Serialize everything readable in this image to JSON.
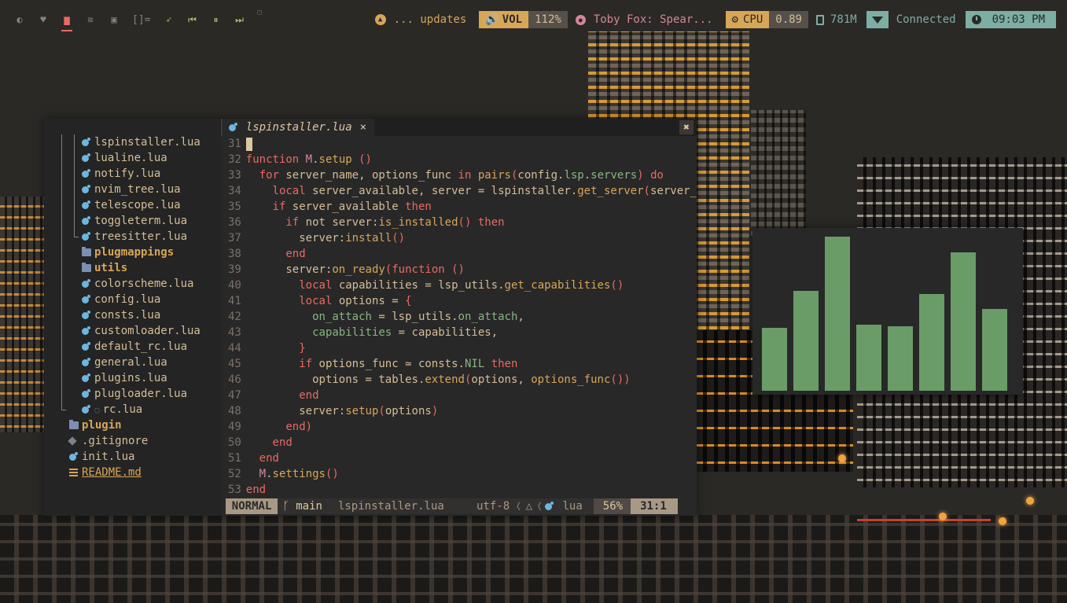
{
  "topbar": {
    "workspaces": [
      {
        "icon": "firefox-icon",
        "glyph": "◐",
        "active": false
      },
      {
        "icon": "pocket-icon",
        "glyph": "♥",
        "active": false
      },
      {
        "icon": "mail-icon",
        "glyph": "▆",
        "active": true
      },
      {
        "icon": "spotify-icon",
        "glyph": "≋",
        "active": false
      },
      {
        "icon": "discord-icon",
        "glyph": "▣",
        "active": false
      }
    ],
    "layout_indicator": "[]=",
    "media_controls": [
      {
        "icon": "rocket-icon",
        "glyph": "➶"
      },
      {
        "icon": "previous-icon",
        "glyph": "⏮"
      },
      {
        "icon": "pause-icon",
        "glyph": "⏸"
      },
      {
        "icon": "next-icon",
        "glyph": "⏭"
      }
    ],
    "updates": "... updates",
    "volume_label": "VOL",
    "volume_value": "112%",
    "music": "Toby Fox: Spear...",
    "cpu_label": "CPU",
    "cpu_value": "0.89",
    "memory": "781M",
    "network": "Connected",
    "clock": "09:03 PM",
    "colors": {
      "accent_yellow": "#d8a657",
      "accent_teal": "#7daea3",
      "accent_pink": "#d3869b",
      "accent_red": "#ea6962"
    }
  },
  "tree": {
    "items": [
      {
        "guides": [
          "v",
          "v"
        ],
        "icon": "lua",
        "name": "lspinstaller.lua"
      },
      {
        "guides": [
          "v",
          "v"
        ],
        "icon": "lua",
        "name": "lualine.lua"
      },
      {
        "guides": [
          "v",
          "v"
        ],
        "icon": "lua",
        "name": "notify.lua"
      },
      {
        "guides": [
          "v",
          "v"
        ],
        "icon": "lua",
        "name": "nvim_tree.lua"
      },
      {
        "guides": [
          "v",
          "v"
        ],
        "icon": "lua",
        "name": "telescope.lua"
      },
      {
        "guides": [
          "v",
          "v"
        ],
        "icon": "lua",
        "name": "toggleterm.lua"
      },
      {
        "guides": [
          "v",
          "end"
        ],
        "icon": "lua",
        "name": "treesitter.lua"
      },
      {
        "guides": [
          "v",
          "blank"
        ],
        "icon": "folder",
        "name": "plugmappings",
        "folder": true
      },
      {
        "guides": [
          "v",
          "blank"
        ],
        "icon": "folder",
        "name": "utils",
        "folder": true
      },
      {
        "guides": [
          "v",
          "blank"
        ],
        "icon": "lua",
        "name": "colorscheme.lua"
      },
      {
        "guides": [
          "v",
          "blank"
        ],
        "icon": "lua",
        "name": "config.lua"
      },
      {
        "guides": [
          "v",
          "blank"
        ],
        "icon": "lua",
        "name": "consts.lua"
      },
      {
        "guides": [
          "v",
          "blank"
        ],
        "icon": "lua",
        "name": "customloader.lua"
      },
      {
        "guides": [
          "v",
          "blank"
        ],
        "icon": "lua",
        "name": "default_rc.lua"
      },
      {
        "guides": [
          "v",
          "blank"
        ],
        "icon": "lua",
        "name": "general.lua"
      },
      {
        "guides": [
          "v",
          "blank"
        ],
        "icon": "lua",
        "name": "plugins.lua"
      },
      {
        "guides": [
          "v",
          "blank"
        ],
        "icon": "lua",
        "name": "plugloader.lua"
      },
      {
        "guides": [
          "end",
          "blank"
        ],
        "icon": "lua",
        "name": "rc.lua",
        "hollow": true
      },
      {
        "guides": [
          "blank"
        ],
        "icon": "folder",
        "name": "plugin",
        "folder": true
      },
      {
        "guides": [
          "blank"
        ],
        "icon": "git",
        "name": ".gitignore"
      },
      {
        "guides": [
          "blank"
        ],
        "icon": "lua",
        "name": "init.lua"
      },
      {
        "guides": [
          "blank"
        ],
        "icon": "md",
        "name": "README.md",
        "md": true
      }
    ]
  },
  "tab": {
    "filename": "lspinstaller.lua",
    "close": "×"
  },
  "window_close": "✖",
  "code": {
    "lines": [
      {
        "n": "31",
        "tokens": [],
        "cursor": true
      },
      {
        "n": "32",
        "tokens": [
          [
            "kw",
            "function "
          ],
          [
            "mod-k",
            "M"
          ],
          [
            "",
            "."
          ],
          [
            "fn",
            "setup"
          ],
          [
            "kw",
            " ()"
          ]
        ]
      },
      {
        "n": "33",
        "tokens": [
          [
            "",
            "  "
          ],
          [
            "kw",
            "for"
          ],
          [
            "",
            " server_name, options_func "
          ],
          [
            "kw",
            "in"
          ],
          [
            "",
            " "
          ],
          [
            "fn",
            "pairs"
          ],
          [
            "kw",
            "("
          ],
          [
            "",
            "config."
          ],
          [
            "fld",
            "lsp"
          ],
          [
            "",
            "."
          ],
          [
            "fld",
            "servers"
          ],
          [
            "kw",
            ")"
          ],
          [
            "",
            " "
          ],
          [
            "kw",
            "do"
          ]
        ]
      },
      {
        "n": "34",
        "tokens": [
          [
            "",
            "    "
          ],
          [
            "kw",
            "local"
          ],
          [
            "",
            " server_available, server = lspinstaller."
          ],
          [
            "fn",
            "get_server"
          ],
          [
            "kw",
            "("
          ],
          [
            "",
            "server_"
          ]
        ]
      },
      {
        "n": "35",
        "tokens": [
          [
            "",
            "    "
          ],
          [
            "kw",
            "if"
          ],
          [
            "",
            " server_available "
          ],
          [
            "kw",
            "then"
          ]
        ]
      },
      {
        "n": "36",
        "tokens": [
          [
            "",
            "      "
          ],
          [
            "kw",
            "if"
          ],
          [
            "",
            " not server:"
          ],
          [
            "fn",
            "is_installed"
          ],
          [
            "kw",
            "()"
          ],
          [
            "",
            " "
          ],
          [
            "kw",
            "then"
          ]
        ]
      },
      {
        "n": "37",
        "tokens": [
          [
            "",
            "        server:"
          ],
          [
            "fn",
            "install"
          ],
          [
            "kw",
            "()"
          ]
        ]
      },
      {
        "n": "38",
        "tokens": [
          [
            "",
            "      "
          ],
          [
            "kw",
            "end"
          ]
        ]
      },
      {
        "n": "39",
        "tokens": [
          [
            "",
            "      server:"
          ],
          [
            "fn",
            "on_ready"
          ],
          [
            "kw",
            "(function ()"
          ]
        ]
      },
      {
        "n": "40",
        "tokens": [
          [
            "",
            "        "
          ],
          [
            "kw",
            "local"
          ],
          [
            "",
            " capabilities = lsp_utils."
          ],
          [
            "fn",
            "get_capabilities"
          ],
          [
            "kw",
            "()"
          ]
        ]
      },
      {
        "n": "41",
        "tokens": [
          [
            "",
            "        "
          ],
          [
            "kw",
            "local"
          ],
          [
            "",
            " options = "
          ],
          [
            "kw",
            "{"
          ]
        ]
      },
      {
        "n": "42",
        "tokens": [
          [
            "",
            "          "
          ],
          [
            "fld",
            "on_attach"
          ],
          [
            "",
            " = lsp_utils."
          ],
          [
            "fld",
            "on_attach"
          ],
          [
            "",
            ","
          ]
        ]
      },
      {
        "n": "43",
        "tokens": [
          [
            "",
            "          "
          ],
          [
            "fld",
            "capabilities"
          ],
          [
            "",
            " = capabilities,"
          ]
        ]
      },
      {
        "n": "44",
        "tokens": [
          [
            "",
            "        "
          ],
          [
            "kw",
            "}"
          ]
        ]
      },
      {
        "n": "45",
        "tokens": [
          [
            "",
            "        "
          ],
          [
            "kw",
            "if"
          ],
          [
            "",
            " options_func ≃ consts."
          ],
          [
            "fld",
            "NIL"
          ],
          [
            "",
            " "
          ],
          [
            "kw",
            "then"
          ]
        ]
      },
      {
        "n": "46",
        "tokens": [
          [
            "",
            "          options = tables."
          ],
          [
            "fn",
            "extend"
          ],
          [
            "kw",
            "("
          ],
          [
            "",
            "options, "
          ],
          [
            "fn",
            "options_func"
          ],
          [
            "kw",
            "())"
          ]
        ]
      },
      {
        "n": "47",
        "tokens": [
          [
            "",
            "        "
          ],
          [
            "kw",
            "end"
          ]
        ]
      },
      {
        "n": "48",
        "tokens": [
          [
            "",
            "        server:"
          ],
          [
            "fn",
            "setup"
          ],
          [
            "kw",
            "("
          ],
          [
            "",
            "options"
          ],
          [
            "kw",
            ")"
          ]
        ]
      },
      {
        "n": "49",
        "tokens": [
          [
            "",
            "      "
          ],
          [
            "kw",
            "end)"
          ]
        ]
      },
      {
        "n": "50",
        "tokens": [
          [
            "",
            "    "
          ],
          [
            "kw",
            "end"
          ]
        ]
      },
      {
        "n": "51",
        "tokens": [
          [
            "",
            "  "
          ],
          [
            "kw",
            "end"
          ]
        ]
      },
      {
        "n": "52",
        "tokens": [
          [
            "",
            "  "
          ],
          [
            "mod-k",
            "M"
          ],
          [
            "",
            "."
          ],
          [
            "fn",
            "settings"
          ],
          [
            "kw",
            "()"
          ]
        ]
      },
      {
        "n": "53",
        "tokens": [
          [
            "kw",
            "end"
          ]
        ]
      }
    ]
  },
  "statusline": {
    "mode": "NORMAL",
    "branch_icon": "ᚴ",
    "branch": "main",
    "file": "lspinstaller.lua",
    "encoding": "utf-8",
    "os_icon": "🐧",
    "filetype": "lua",
    "percent": "56%",
    "position": "31:1"
  },
  "visualizer": {
    "bar_levels": [
      0.41,
      0.65,
      1.0,
      0.43,
      0.42,
      0.63,
      0.9,
      0.53
    ],
    "color": "#6a9c68"
  }
}
